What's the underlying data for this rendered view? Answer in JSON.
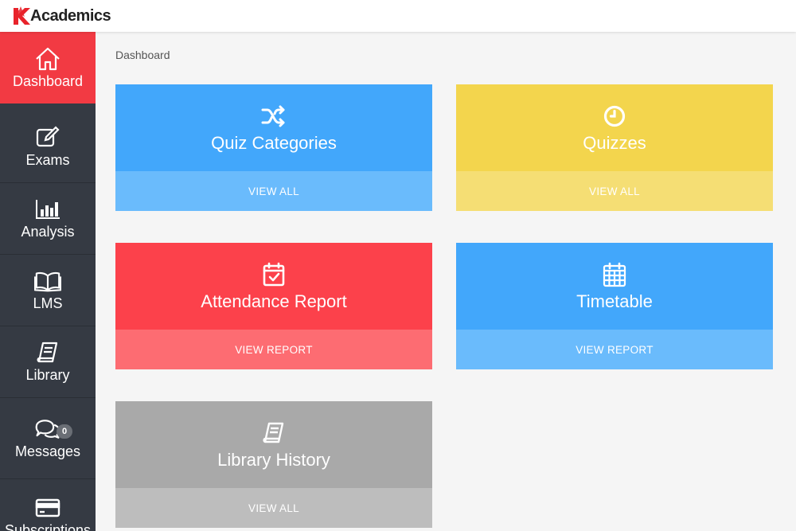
{
  "app": {
    "logo_text": "Academics",
    "brand_color": "#e8232b"
  },
  "sidebar": {
    "items": [
      {
        "label": "Dashboard",
        "icon": "home-icon",
        "active": true
      },
      {
        "label": "Exams",
        "icon": "edit-icon"
      },
      {
        "label": "Analysis",
        "icon": "bar-chart-icon"
      },
      {
        "label": "LMS",
        "icon": "open-book-icon"
      },
      {
        "label": "Library",
        "icon": "book-icon"
      },
      {
        "label": "Messages",
        "icon": "chat-bubbles-icon",
        "badge": "0"
      },
      {
        "label": "Subscriptions",
        "icon": "credit-card-icon"
      }
    ]
  },
  "breadcrumb": "Dashboard",
  "cards": [
    {
      "title": "Quiz Categories",
      "action": "VIEW ALL",
      "icon": "shuffle-icon",
      "color": "#42a7fb"
    },
    {
      "title": "Quizzes",
      "action": "VIEW ALL",
      "icon": "clock-icon",
      "color": "#f3d54d"
    },
    {
      "title": "Attendance Report",
      "action": "VIEW REPORT",
      "icon": "calendar-check-icon",
      "color": "#fc414b"
    },
    {
      "title": "Timetable",
      "action": "VIEW REPORT",
      "icon": "calendar-grid-icon",
      "color": "#42a7fb"
    },
    {
      "title": "Library History",
      "action": "VIEW ALL",
      "icon": "book-icon",
      "color": "#a9a9a9"
    }
  ]
}
